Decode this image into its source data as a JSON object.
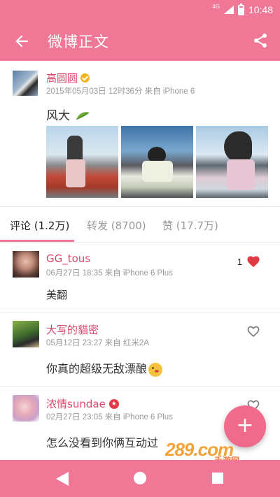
{
  "status_bar": {
    "network": "4G",
    "time": "10:48"
  },
  "app_bar": {
    "title": "微博正文",
    "back_icon": "arrow-back-icon",
    "share_icon": "share-icon"
  },
  "post": {
    "author": "高圆圆",
    "verified": true,
    "meta": "2015年05月03日 12时36分 来自 iPhone 6",
    "text": "风大",
    "emoji": "leaf-icon",
    "photo_count": 3
  },
  "tabs": [
    {
      "label": "评论 (1.2万)",
      "active": true
    },
    {
      "label": "转发 (8700)",
      "active": false
    },
    {
      "label": "赞 (17.7万)",
      "active": false
    }
  ],
  "comments": [
    {
      "name": "GG_tous",
      "meta": "06月27日 18:35 来自 iPhone 6 Plus",
      "text": "美翻",
      "likes": "1",
      "liked": true
    },
    {
      "name": "大写的貓密",
      "meta": "05月12日 23:27 来自 红米2A",
      "text": "你真的超级无敌漂酿",
      "liked": false
    },
    {
      "name": "浓情sundae",
      "meta": "02月27日 23:05 来自 iPhone 6 Plus",
      "text": "怎么没看到你俩互动过",
      "liked": false,
      "badge": "red-badge"
    }
  ],
  "fab": {
    "label": "+"
  },
  "watermark": {
    "logo": "289.com",
    "sub": "手游网"
  },
  "colors": {
    "primary": "#f07896",
    "accent_name": "#e0456b",
    "heart": "#e23a44",
    "fab": "#f06a8c"
  }
}
